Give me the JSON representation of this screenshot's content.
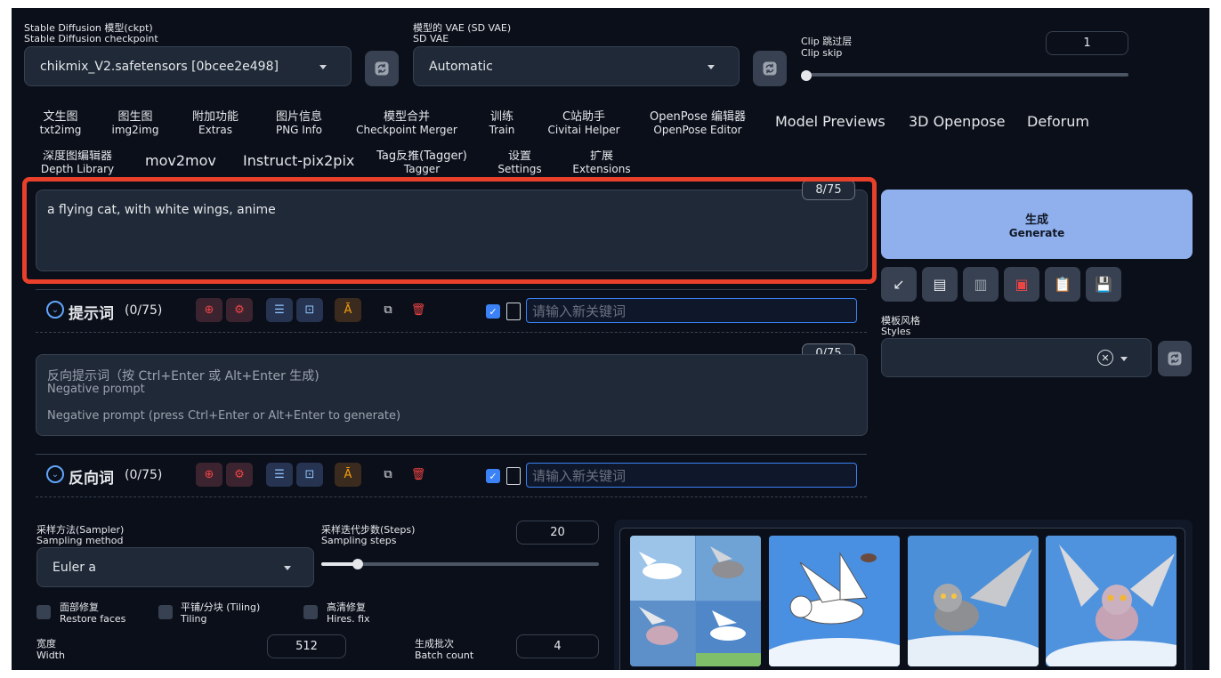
{
  "checkpoint": {
    "label_cn": "Stable Diffusion 模型(ckpt)",
    "label_en": "Stable Diffusion checkpoint",
    "value": "chikmix_V2.safetensors [0bcee2e498]"
  },
  "vae": {
    "label_cn": "模型的 VAE (SD VAE)",
    "label_en": "SD VAE",
    "value": "Automatic"
  },
  "clip_skip": {
    "label_cn": "Clip 跳过层",
    "label_en": "Clip skip",
    "value": "1",
    "level": 0
  },
  "tabs_row1": [
    {
      "cn": "文生图",
      "en": "txt2img"
    },
    {
      "cn": "图生图",
      "en": "img2img"
    },
    {
      "cn": "附加功能",
      "en": "Extras"
    },
    {
      "cn": "图片信息",
      "en": "PNG Info"
    },
    {
      "cn": "模型合并",
      "en": "Checkpoint Merger"
    },
    {
      "cn": "训练",
      "en": "Train"
    },
    {
      "cn": "C站助手",
      "en": "Civitai Helper"
    },
    {
      "cn": "OpenPose 编辑器",
      "en": "OpenPose Editor"
    },
    {
      "single": "Model Previews"
    },
    {
      "single": "3D Openpose"
    },
    {
      "single": "Deforum"
    }
  ],
  "tabs_row2": [
    {
      "cn": "深度图编辑器",
      "en": "Depth Library"
    },
    {
      "single": "mov2mov"
    },
    {
      "single": "Instruct-pix2pix"
    },
    {
      "cn": "Tag反推(Tagger)",
      "en": "Tagger"
    },
    {
      "cn": "设置",
      "en": "Settings"
    },
    {
      "cn": "扩展",
      "en": "Extensions"
    }
  ],
  "prompt": {
    "text": "a flying cat, with white wings, anime",
    "token_count": "8/75",
    "highlight_color": "#e8402b"
  },
  "prompt_toolbar": {
    "title": "提示词",
    "count": "(0/75)",
    "keyword_placeholder": "请输入新关键词"
  },
  "negative": {
    "label_cn": "反向提示词（按 Ctrl+Enter 或 Alt+Enter 生成)",
    "label_en": "Negative prompt",
    "placeholder": "Negative prompt (press Ctrl+Enter or Alt+Enter to generate)",
    "token_count": "0/75"
  },
  "negative_toolbar": {
    "title": "反向词",
    "count": "(0/75)",
    "keyword_placeholder": "请输入新关键词"
  },
  "generate": {
    "cn": "生成",
    "en": "Generate",
    "color": "#8fb0ec"
  },
  "styles": {
    "label_cn": "模板风格",
    "label_en": "Styles"
  },
  "sampler": {
    "label_cn": "采样方法(Sampler)",
    "label_en": "Sampling method",
    "value": "Euler a"
  },
  "steps": {
    "label_cn": "采样迭代步数(Steps)",
    "label_en": "Sampling steps",
    "value": "20",
    "level": 0.13
  },
  "checkboxes": [
    {
      "cn": "面部修复",
      "en": "Restore faces"
    },
    {
      "cn": "平铺/分块 (Tiling)",
      "en": "Tiling"
    },
    {
      "cn": "高清修复",
      "en": "Hires. fix"
    }
  ],
  "width": {
    "label_cn": "宽度",
    "label_en": "Width",
    "value": "512"
  },
  "batch_count": {
    "label_cn": "生成批次",
    "label_en": "Batch count",
    "value": "4"
  },
  "colors": {
    "background": "#0b0f19",
    "panel": "#1f2937",
    "accent": "#8fb0ec"
  }
}
